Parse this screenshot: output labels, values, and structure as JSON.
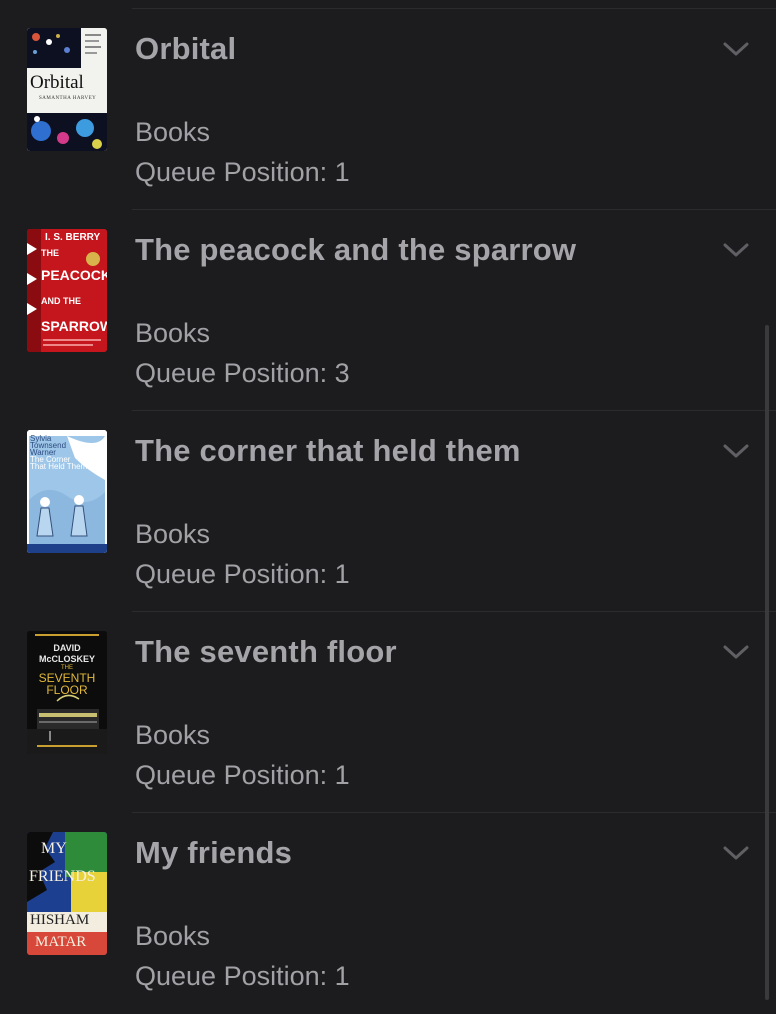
{
  "items": [
    {
      "title": "Orbital",
      "category": "Books",
      "queue": "Queue Position: 1",
      "cover": {
        "title": "Orbital",
        "author": "SAMANTHA HARVEY"
      }
    },
    {
      "title": "The peacock and the sparrow",
      "category": "Books",
      "queue": "Queue Position: 3",
      "cover": {
        "author": "I. S. BERRY",
        "l1": "THE",
        "l2": "PEACOCK",
        "l3": "AND THE",
        "l4": "SPARROW"
      }
    },
    {
      "title": "The corner that held them",
      "category": "Books",
      "queue": "Queue Position: 1",
      "cover": {
        "author1": "Sylvia",
        "author2": "Townsend",
        "author3": "Warner",
        "t1": "The Corner",
        "t2": "That Held Them"
      }
    },
    {
      "title": "The seventh floor",
      "category": "Books",
      "queue": "Queue Position: 1",
      "cover": {
        "a1": "DAVID",
        "a2": "McCLOSKEY",
        "t0": "THE",
        "t1": "SEVENTH",
        "t2": "FLOOR"
      }
    },
    {
      "title": "My friends",
      "category": "Books",
      "queue": "Queue Position: 1",
      "cover": {
        "t1": "MY",
        "t2": "FRIENDS",
        "a1": "HISHAM",
        "a2": "MATAR"
      }
    }
  ]
}
